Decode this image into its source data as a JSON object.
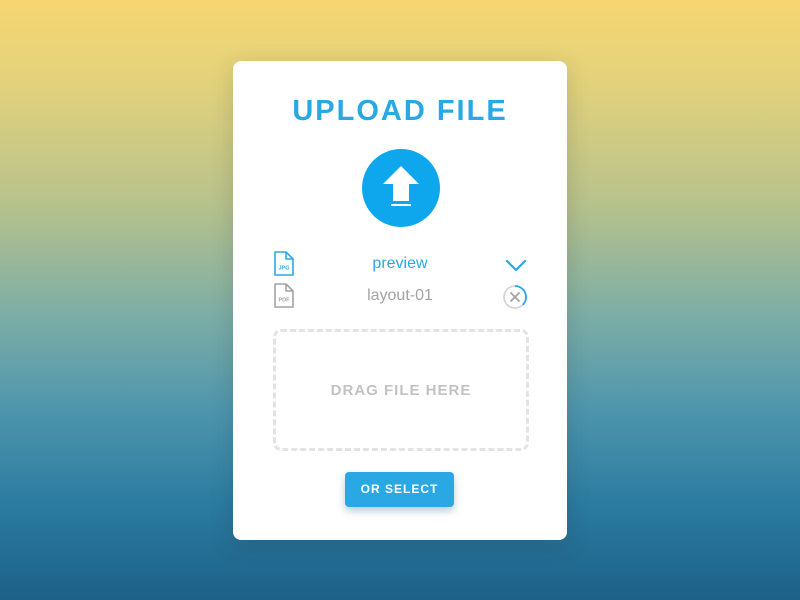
{
  "card": {
    "title": "UPLOAD FILE"
  },
  "upload_icon": "upload-arrow-icon",
  "files": [
    {
      "type_label": "JPG",
      "name": "preview",
      "status": "completed",
      "status_icon": "check-icon",
      "color": "#2aa8e3"
    },
    {
      "type_label": "PDF",
      "name": "layout-01",
      "status": "in-progress",
      "status_icon": "cancel-icon",
      "color": "#a3a3a3"
    }
  ],
  "dropzone": {
    "label": "DRAG FILE HERE"
  },
  "select_button": {
    "label": "OR SELECT"
  },
  "colors": {
    "accent": "#2aa8e3",
    "upload_circle": "#0ea6ec",
    "muted": "#a3a3a3",
    "dashed_border": "#e3e3e3"
  }
}
